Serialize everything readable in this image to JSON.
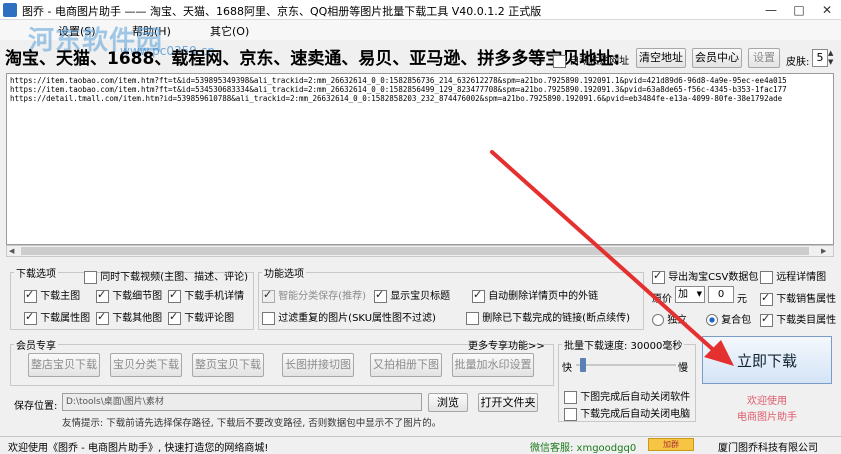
{
  "window": {
    "title": "图乔 - 电商图片助手 —— 淘宝、天猫、1688阿里、京东、QQ相册等图片批量下载工具 V40.0.1.2 正式版",
    "min_glyph": "—",
    "max_glyph": "□",
    "close_glyph": "✕"
  },
  "menu": {
    "items": [
      "设置(S)",
      "帮助(H)",
      "其它(O)"
    ]
  },
  "watermark": {
    "text": "河东软件园",
    "url": "www.pc0359.cn"
  },
  "url_input": {
    "label": "淘宝、天猫、1688、载程网、京东、速卖通、易贝、亚马逊、拼多多等宝贝地址:",
    "auto_paste_label": "自动粘贴网址",
    "clear_button": "清空地址",
    "member_button": "会员中心",
    "settings_button": "设置",
    "skin_label": "皮肤:",
    "skin_value": "5",
    "urls": [
      "https://item.taobao.com/item.htm?ft=t&id=539895349398&ali_trackid=2:mm_26632614_0_0:1582856736_214_632612278&spm=a21bo.7925890.192091.1&pvid=421d89d6-96d8-4a9e-95ec-ee4a015",
      "https://item.taobao.com/item.htm?ft=t&id=534530683334&ali_trackid=2:mm_26632614_0_0:1582856499_129_823477708&spm=a21bo.7925890.192091.3&pvid=63a8de65-f56c-4345-b353-1fac177",
      "https://detail.tmall.com/item.htm?id=539859610788&ali_trackid=2:mm_26632614_0_0:1582858203_232_874476002&spm=a21bo.7925890.192091.6&pvid=eb3484fe-e13a-4099-80fe-38e1792ade"
    ]
  },
  "download_options": {
    "title": "下载选项",
    "video_option": "同时下载视频(主图、描述、评论)",
    "items": [
      {
        "label": "下载主图",
        "checked": true
      },
      {
        "label": "下载细节图",
        "checked": true
      },
      {
        "label": "下载手机详情",
        "checked": true
      },
      {
        "label": "下载属性图",
        "checked": true
      },
      {
        "label": "下载其他图",
        "checked": true
      },
      {
        "label": "下载评论图",
        "checked": true
      }
    ]
  },
  "function_options": {
    "title": "功能选项",
    "items": [
      {
        "label": "智能分类保存(推荐)",
        "checked": true,
        "disabled": true
      },
      {
        "label": "显示宝贝标题",
        "checked": true
      },
      {
        "label": "自动删除详情页中的外链",
        "checked": true
      },
      {
        "label": "过滤重复的图片(SKU属性图不过滤)",
        "checked": false
      },
      {
        "label": "删除已下载完成的链接(断点续传)",
        "checked": false
      }
    ]
  },
  "right_options": {
    "export_csv": "导出淘宝CSV数据包",
    "remote_detail": "远程详情图",
    "price_label": "原价",
    "price_op": "加",
    "price_value": "0",
    "price_unit": "元",
    "sales_attr": "下载销售属性",
    "independent": "独立",
    "combined": "复合包",
    "category_attr": "下载类目属性"
  },
  "member": {
    "title": "会员专享",
    "more": "更多专享功能>>",
    "buttons": [
      "整店宝贝下载",
      "宝贝分类下载",
      "整页宝贝下载",
      "长图拼接切图",
      "又拍相册下图",
      "批量加水印设置"
    ]
  },
  "speed": {
    "title": "批量下载速度: 30000毫秒",
    "fast": "快",
    "slow": "慢",
    "close_software": "下图完成后自动关闭软件",
    "shutdown": "下载完成后自动关闭电脑"
  },
  "save": {
    "label": "保存位置:",
    "path": "D:\\tools\\桌面\\图片\\素材",
    "browse": "浏览",
    "open_folder": "打开文件夹",
    "tip": "友情提示: 下载前请先选择保存路径, 下载后不要改变路径, 否则数据包中显示不了图片的。"
  },
  "download_button": "立即下载",
  "welcome": {
    "line1": "欢迎使用",
    "line2": "电商图片助手"
  },
  "status": {
    "welcome": "欢迎使用《图乔 - 电商图片助手》, 快速打造您的网络商城!",
    "support": "微信客服: xmgoodgq0",
    "company": "厦门图乔科技有限公司"
  },
  "colors": {
    "accent": "#e02020",
    "link_green": "#1a7a1a",
    "welcome_pink": "#e05a6b"
  }
}
